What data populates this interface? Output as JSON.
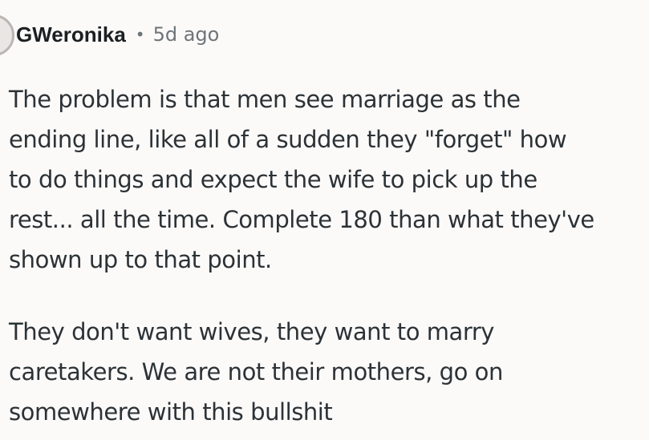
{
  "comment": {
    "author": "GWeronika",
    "separator": "•",
    "time_ago": "5d ago",
    "paragraphs": [
      "The problem is that men see marriage as the\nending line, like all of a sudden they \"forget\" how\nto do things and expect the wife to pick up the\nrest... all the time. Complete 180 than what they've\nshown up to that point.",
      "They don't want wives, they want to marry\ncaretakers. We are not their mothers, go on\nsomewhere with this bullshit"
    ]
  }
}
